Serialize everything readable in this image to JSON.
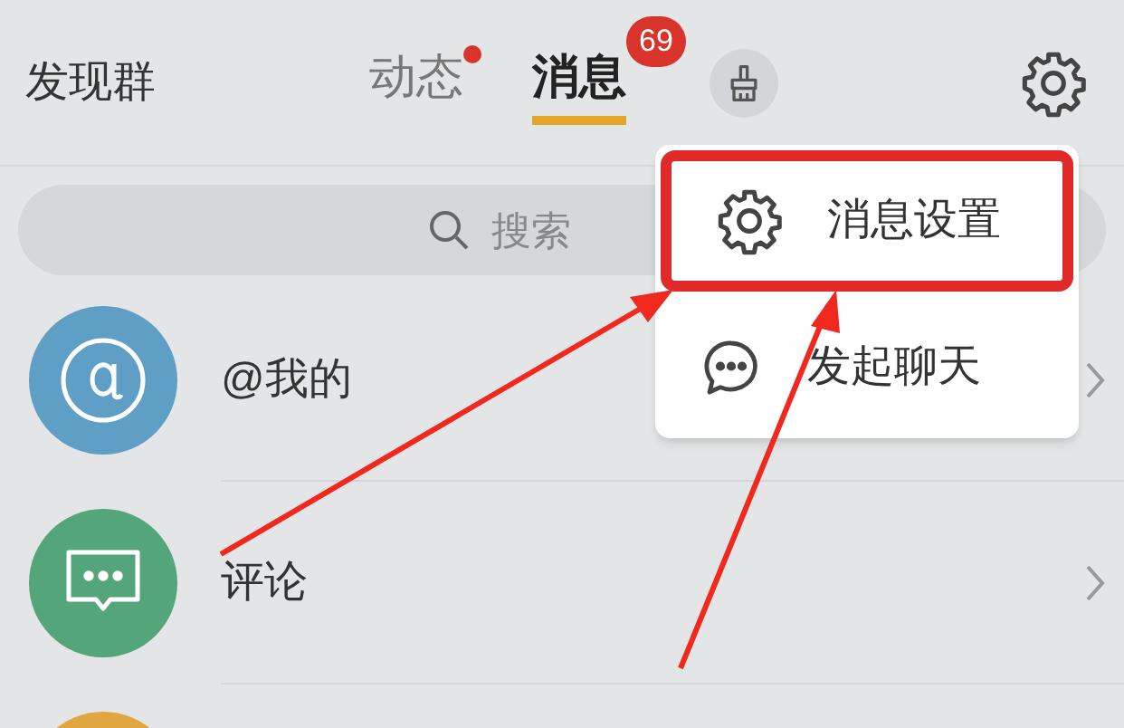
{
  "header": {
    "title": "发现群",
    "tabs": [
      {
        "label": "动态",
        "selected": false,
        "dot": true
      },
      {
        "label": "消息",
        "selected": true,
        "dot": false,
        "badge": "69"
      }
    ]
  },
  "search": {
    "placeholder": "搜索"
  },
  "conversations": [
    {
      "label": "@我的",
      "color": "#5f9fc6",
      "kind": "at"
    },
    {
      "label": "评论",
      "color": "#55a57a",
      "kind": "comment"
    },
    {
      "color": "#e0a640",
      "kind": "other"
    }
  ],
  "menu": [
    {
      "label": "消息设置",
      "kind": "settings",
      "highlighted": true
    },
    {
      "label": "发起聊天",
      "kind": "chat",
      "highlighted": false
    }
  ]
}
